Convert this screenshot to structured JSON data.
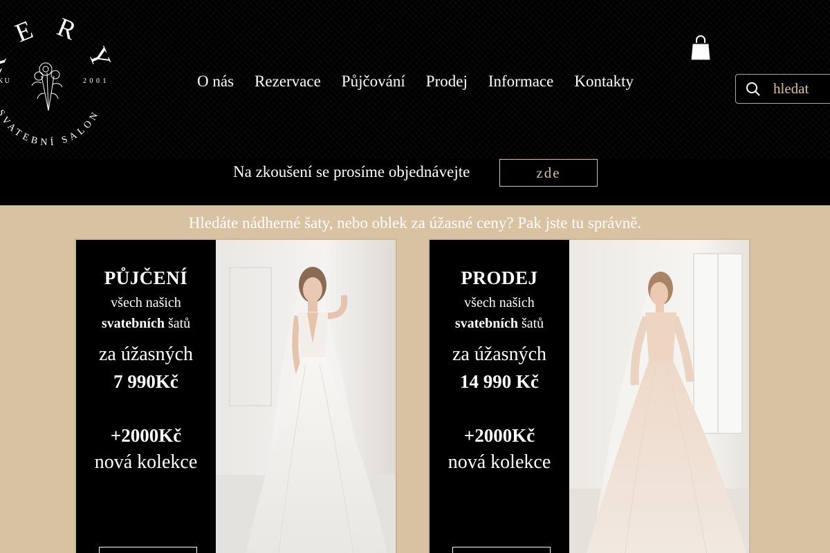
{
  "logo": {
    "letters": "K E R Y",
    "left_text": "OKU",
    "right_text": "2 0 0 1",
    "bottom_text": "SVATEBNÍ SALON"
  },
  "nav": {
    "items": [
      "O nás",
      "Rezervace",
      "Půjčování",
      "Prodej",
      "Informace",
      "Kontakty"
    ]
  },
  "cart": {
    "icon": "shopping-bag-icon"
  },
  "search": {
    "placeholder": "hledat",
    "icon": "search-icon"
  },
  "booking": {
    "text": "Na zkoušení se prosíme objednávejte",
    "button_label": "zde"
  },
  "tagline": "Hledáte nádherné šaty, nebo oblek za úžasné ceny? Pak jste tu správně.",
  "cards": [
    {
      "heading": "PŮJČENÍ",
      "line1": "všech našich",
      "line2_bold": "svatebních",
      "line2_rest": " šatů",
      "amazing": "za úžasných",
      "price": "7 990Kč",
      "extra": "+2000Kč",
      "collection": "nová kolekce"
    },
    {
      "heading": "PRODEJ",
      "line1": "všech našich",
      "line2_bold": "svatebních",
      "line2_rest": " šatů",
      "amazing": "za úžasných",
      "price": "14 990 Kč",
      "extra": "+2000Kč",
      "collection": "nová kolekce"
    }
  ],
  "colors": {
    "header_bg": "#000000",
    "page_bg": "#d9c2a2",
    "accent_gold": "#c9a96e"
  }
}
